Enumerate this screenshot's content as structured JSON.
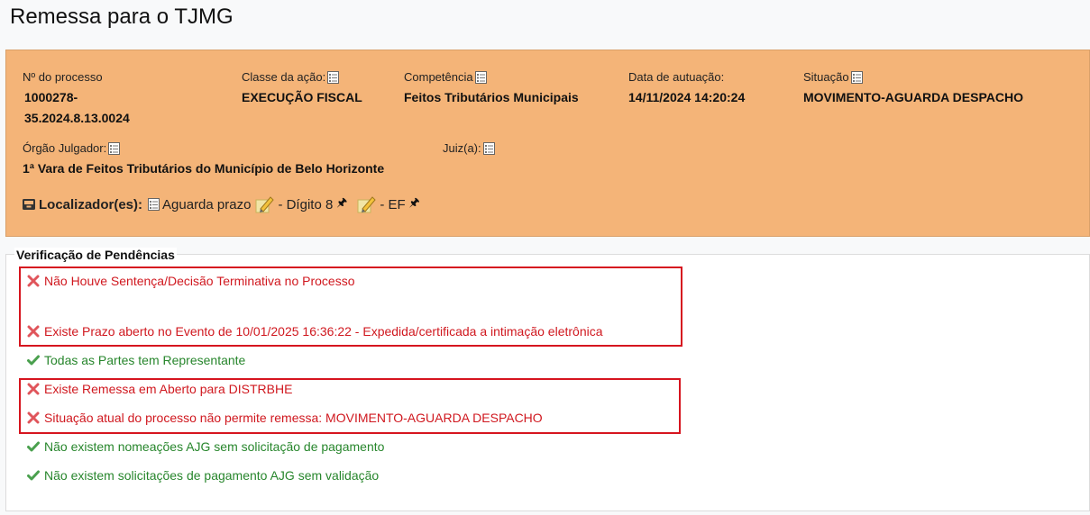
{
  "page": {
    "title": "Remessa para o TJMG"
  },
  "process": {
    "numero_label": "Nº do processo",
    "numero_line1": "1000278-",
    "numero_line2": "35.2024.8.13.0024",
    "classe_label": "Classe da ação:",
    "classe_value": "EXECUÇÃO FISCAL",
    "competencia_label": "Competência",
    "competencia_value": "Feitos Tributários Municipais",
    "data_label": "Data de autuação:",
    "data_value": "14/11/2024 14:20:24",
    "situacao_label": "Situação",
    "situacao_value": "MOVIMENTO-AGUARDA DESPACHO",
    "orgao_label": "Órgão Julgador:",
    "orgao_value": "1ª Vara de Feitos Tributários do Município de Belo Horizonte",
    "juiz_label": "Juiz(a):"
  },
  "localizadores": {
    "label": "Localizador(es):",
    "item1": "Aguarda prazo",
    "item2": "- Dígito 8",
    "item3": "- EF"
  },
  "pendencias": {
    "title": "Verificação de Pendências",
    "items": [
      {
        "status": "error",
        "text": "Não Houve Sentença/Decisão Terminativa no Processo"
      },
      {
        "status": "error",
        "text": "Existe Prazo aberto no Evento de 10/01/2025 16:36:22 - Expedida/certificada a intimação eletrônica"
      },
      {
        "status": "ok",
        "text": "Todas as Partes tem Representante"
      },
      {
        "status": "error",
        "text": "Existe Remessa em Aberto para DISTRBHE"
      },
      {
        "status": "error",
        "text": "Situação atual do processo não permite remessa: MOVIMENTO-AGUARDA DESPACHO"
      },
      {
        "status": "ok",
        "text": "Não existem nomeações AJG sem solicitação de pagamento"
      },
      {
        "status": "ok",
        "text": "Não existem solicitações de pagamento AJG sem validação"
      }
    ]
  },
  "colors": {
    "panel": "#f4b478",
    "error": "#d0181f",
    "ok": "#27862c",
    "highlight_box": "#d6151f"
  },
  "icons": {
    "error": "x-mark-icon",
    "ok": "check-mark-icon",
    "info": "list-details-icon",
    "edit": "pencil-note-icon",
    "pin": "pin-icon",
    "inbox": "inbox-icon"
  }
}
